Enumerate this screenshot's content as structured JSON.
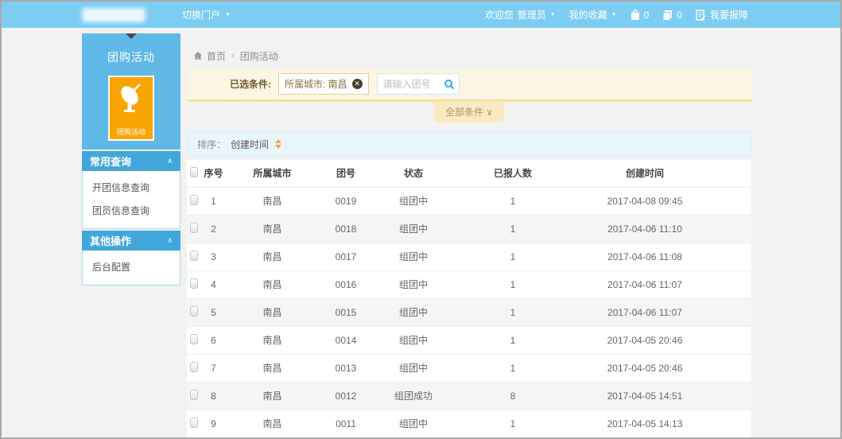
{
  "header": {
    "portal_switch": "切换门户",
    "welcome": "欢迎您",
    "user": "管理员",
    "favorites": "我的收藏",
    "cart_count": "0",
    "message_count": "0",
    "report_issue": "我要报障"
  },
  "sidebar": {
    "app_title": "团购活动",
    "card_label": "团购活动",
    "sections": [
      {
        "title": "常用查询",
        "items": [
          "开团信息查询",
          "团员信息查询"
        ]
      },
      {
        "title": "其他操作",
        "items": [
          "后台配置"
        ]
      }
    ]
  },
  "breadcrumb": {
    "home": "首页",
    "separator": "›",
    "current": "团购活动"
  },
  "filter": {
    "label": "已选条件:",
    "selected_tag": "所属城市: 南昌",
    "search_placeholder": "请输入团号",
    "all_conditions_label": "全部条件 ∨"
  },
  "sort": {
    "label": "排序：",
    "field": "创建时间"
  },
  "table": {
    "columns": [
      "序号",
      "所属城市",
      "团号",
      "状态",
      "已报人数",
      "创建时间"
    ],
    "rows": [
      [
        "1",
        "南昌",
        "0019",
        "组团中",
        "1",
        "2017-04-08 09:45"
      ],
      [
        "2",
        "南昌",
        "0018",
        "组团中",
        "1",
        "2017-04-06 11:10"
      ],
      [
        "3",
        "南昌",
        "0017",
        "组团中",
        "1",
        "2017-04-06 11:08"
      ],
      [
        "4",
        "南昌",
        "0016",
        "组团中",
        "1",
        "2017-04-06 11:07"
      ],
      [
        "5",
        "南昌",
        "0015",
        "组团中",
        "1",
        "2017-04-06 11:07"
      ],
      [
        "6",
        "南昌",
        "0014",
        "组团中",
        "1",
        "2017-04-05 20:46"
      ],
      [
        "7",
        "南昌",
        "0013",
        "组团中",
        "1",
        "2017-04-05 20:46"
      ],
      [
        "8",
        "南昌",
        "0012",
        "组团成功",
        "8",
        "2017-04-05 14:51"
      ],
      [
        "9",
        "南昌",
        "0011",
        "组团中",
        "1",
        "2017-04-05 14:13"
      ]
    ]
  },
  "colors": {
    "topbar_blue": "#7dcdf2",
    "sidebar_blue": "#60b8e6",
    "section_blue": "#41a7db",
    "card_orange": "#f9a400",
    "filter_cream": "#fdf5e3",
    "filter_border": "#f8dfa0",
    "accent_blue": "#1e9fe0",
    "sort_arrow_orange": "#f5a623"
  }
}
